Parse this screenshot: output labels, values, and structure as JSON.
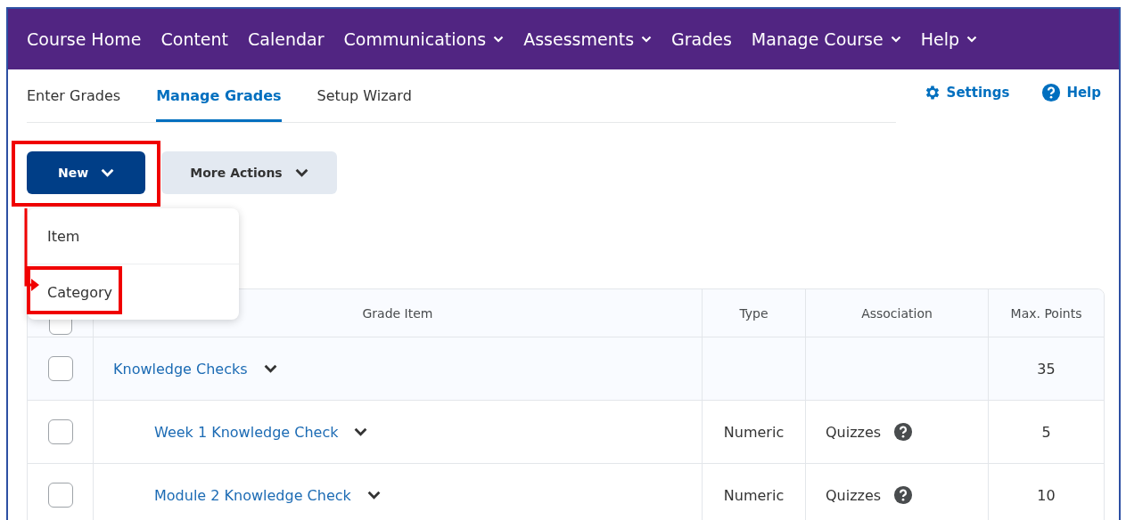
{
  "nav": {
    "items": [
      {
        "label": "Course Home",
        "dropdown": false
      },
      {
        "label": "Content",
        "dropdown": false
      },
      {
        "label": "Calendar",
        "dropdown": false
      },
      {
        "label": "Communications",
        "dropdown": true
      },
      {
        "label": "Assessments",
        "dropdown": true
      },
      {
        "label": "Grades",
        "dropdown": false
      },
      {
        "label": "Manage Course",
        "dropdown": true
      },
      {
        "label": "Help",
        "dropdown": true
      }
    ]
  },
  "tabs": [
    {
      "label": "Enter Grades",
      "selected": false
    },
    {
      "label": "Manage Grades",
      "selected": true
    },
    {
      "label": "Setup Wizard",
      "selected": false
    }
  ],
  "links": [
    {
      "kind": "settings",
      "label": "Settings"
    },
    {
      "kind": "help",
      "label": "Help"
    }
  ],
  "buttons": [
    {
      "kind": "primary",
      "label": "New",
      "highlighted": true
    },
    {
      "kind": "secondary",
      "label": "More Actions",
      "highlighted": false
    }
  ],
  "new_menu": {
    "items": [
      {
        "label": "Item",
        "highlighted": false
      },
      {
        "label": "Category",
        "highlighted": true
      }
    ]
  },
  "table": {
    "select_all": {
      "checked": false
    },
    "columns": [
      "Grade Item",
      "Type",
      "Association",
      "Max. Points"
    ],
    "rows": [
      {
        "name": "Knowledge Checks",
        "max_points": "35",
        "checked": false,
        "children": [
          {
            "name": "Week 1 Knowledge Check",
            "type": "Numeric",
            "association": "Quizzes",
            "max_points": "5",
            "checked": false
          },
          {
            "name": "Module 2 Knowledge Check",
            "type": "Numeric",
            "association": "Quizzes",
            "max_points": "10",
            "checked": false
          }
        ]
      }
    ]
  }
}
